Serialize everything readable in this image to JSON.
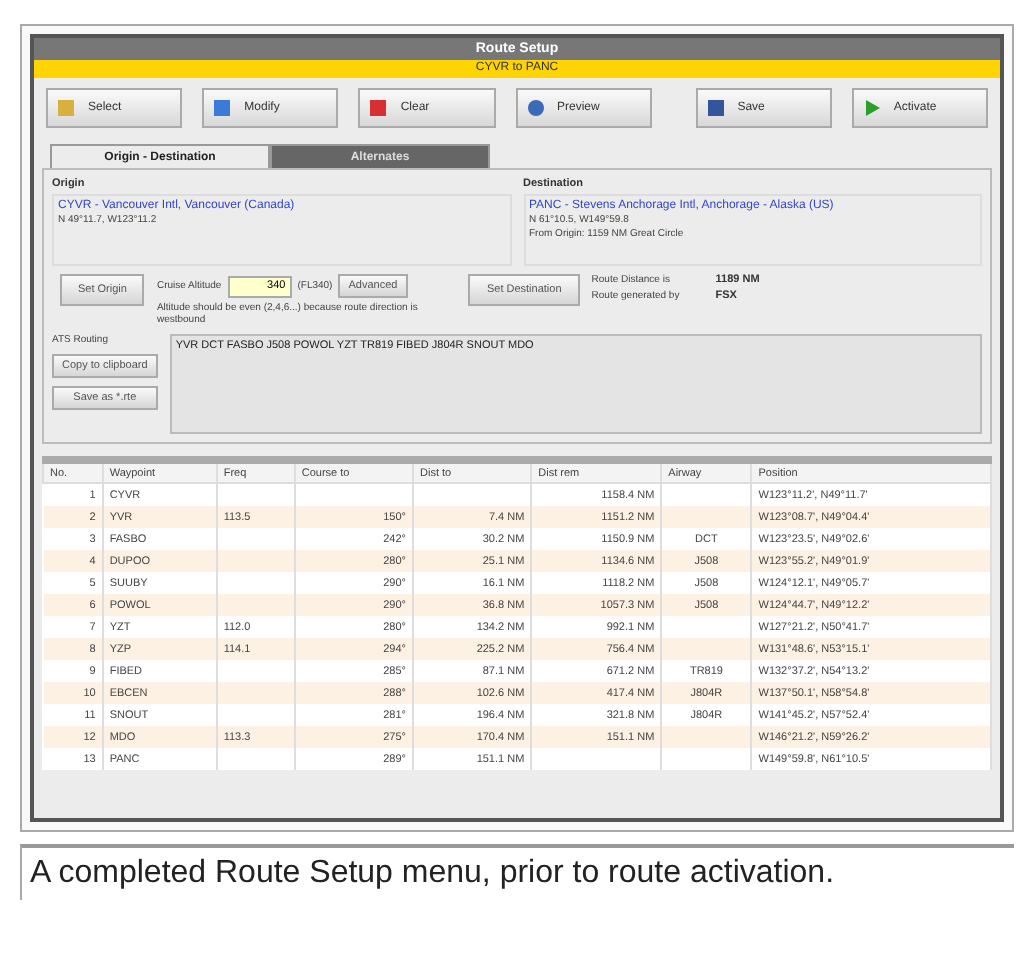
{
  "window": {
    "title": "Route Setup",
    "route": "CYVR to PANC"
  },
  "toolbar": [
    {
      "label": "Select"
    },
    {
      "label": "Modify"
    },
    {
      "label": "Clear"
    },
    {
      "label": "Preview"
    },
    {
      "label": "Save"
    },
    {
      "label": "Activate"
    }
  ],
  "tabs": [
    {
      "label": "Origin - Destination",
      "selected": true
    },
    {
      "label": "Alternates",
      "selected": false
    }
  ],
  "origin": {
    "heading": "Origin",
    "name": "CYVR - Vancouver Intl, Vancouver (Canada)",
    "coords": "N 49°11.7, W123°11.2",
    "button": "Set Origin"
  },
  "destination": {
    "heading": "Destination",
    "name": "PANC - Stevens Anchorage Intl, Anchorage - Alaska (US)",
    "coords": "N 61°10.5, W149°59.8",
    "note": "From Origin: 1159 NM Great Circle",
    "button": "Set Destination"
  },
  "cruise": {
    "label": "Cruise Altitude",
    "value": "340",
    "unit": "(FL340)",
    "button": "Advanced",
    "hint": "Altitude should be even (2,4,6...) because route direction is westbound"
  },
  "route_info": [
    {
      "label": "Route Distance is",
      "value": "1189 NM"
    },
    {
      "label": "Route generated by",
      "value": "FSX"
    }
  ],
  "ats": {
    "label": "ATS Routing",
    "text": "YVR DCT FASBO J508 POWOL  YZT TR819 FIBED J804R SNOUT  MDO",
    "buttons": [
      "Copy to clipboard",
      "Save as *.rte"
    ]
  },
  "table": {
    "columns": [
      "No.",
      "Waypoint",
      "Freq",
      "Course to",
      "Dist to",
      "Dist rem",
      "Airway",
      "Position"
    ],
    "rows": [
      [
        "1",
        "CYVR",
        "",
        "",
        "",
        "1158.4 NM",
        "",
        "W123°11.2', N49°11.7'"
      ],
      [
        "2",
        "YVR",
        "113.5",
        "150°",
        "7.4 NM",
        "1151.2 NM",
        "",
        "W123°08.7', N49°04.4'"
      ],
      [
        "3",
        "FASBO",
        "",
        "242°",
        "30.2 NM",
        "1150.9 NM",
        "DCT",
        "W123°23.5', N49°02.6'"
      ],
      [
        "4",
        "DUPOO",
        "",
        "280°",
        "25.1 NM",
        "1134.6 NM",
        "J508",
        "W123°55.2', N49°01.9'"
      ],
      [
        "5",
        "SUUBY",
        "",
        "290°",
        "16.1 NM",
        "1118.2 NM",
        "J508",
        "W124°12.1', N49°05.7'"
      ],
      [
        "6",
        "POWOL",
        "",
        "290°",
        "36.8 NM",
        "1057.3 NM",
        "J508",
        "W124°44.7', N49°12.2'"
      ],
      [
        "7",
        "YZT",
        "112.0",
        "280°",
        "134.2 NM",
        "992.1 NM",
        "",
        "W127°21.2', N50°41.7'"
      ],
      [
        "8",
        "YZP",
        "114.1",
        "294°",
        "225.2 NM",
        "756.4 NM",
        "",
        "W131°48.6', N53°15.1'"
      ],
      [
        "9",
        "FIBED",
        "",
        "285°",
        "87.1 NM",
        "671.2 NM",
        "TR819",
        "W132°37.2', N54°13.2'"
      ],
      [
        "10",
        "EBCEN",
        "",
        "288°",
        "102.6 NM",
        "417.4 NM",
        "J804R",
        "W137°50.1', N58°54.8'"
      ],
      [
        "11",
        "SNOUT",
        "",
        "281°",
        "196.4 NM",
        "321.8 NM",
        "J804R",
        "W141°45.2', N57°52.4'"
      ],
      [
        "12",
        "MDO",
        "113.3",
        "275°",
        "170.4 NM",
        "151.1 NM",
        "",
        "W146°21.2', N59°26.2'"
      ],
      [
        "13",
        "PANC",
        "",
        "289°",
        "151.1 NM",
        "",
        "",
        "W149°59.8', N61°10.5'"
      ]
    ]
  },
  "caption": "A completed Route Setup menu, prior to route activation."
}
